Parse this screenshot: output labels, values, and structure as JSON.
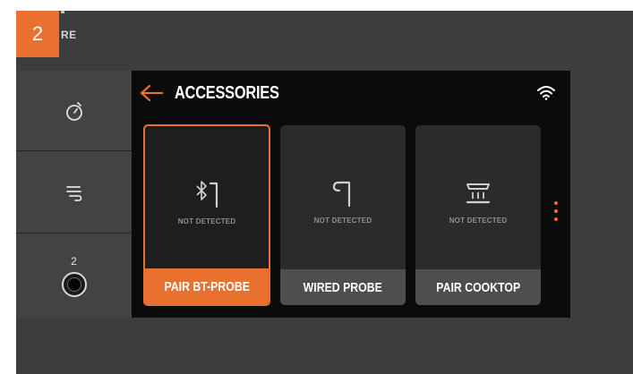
{
  "step_badge": "2",
  "bezel_label": "RE",
  "side_panel": {
    "items": [
      {
        "icon": "timer-icon"
      },
      {
        "icon": "smoke-icon"
      },
      {
        "icon": "probe-port-icon",
        "badge": "2"
      }
    ]
  },
  "screen": {
    "title": "ACCESSORIES",
    "back_icon": "back-arrow-icon",
    "status_icon": "wifi-icon",
    "cards": [
      {
        "label": "PAIR BT-PROBE",
        "status": "NOT DETECTED",
        "icon": "bluetooth-probe-icon",
        "selected": true
      },
      {
        "label": "WIRED PROBE",
        "status": "NOT DETECTED",
        "icon": "wired-probe-icon",
        "selected": false
      },
      {
        "label": "PAIR COOKTOP",
        "status": "NOT DETECTED",
        "icon": "cooktop-icon",
        "selected": false
      }
    ],
    "more_icon": "more-vertical-icon"
  },
  "colors": {
    "accent": "#e8712f",
    "bezel": "#3d3d3d",
    "screen_bg": "#0b0b0b",
    "card_bg": "#2b2b2b",
    "card_label_bg": "#4e4e4e"
  }
}
